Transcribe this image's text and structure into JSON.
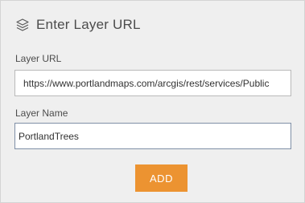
{
  "header": {
    "icon": "layers-icon",
    "title": "Enter Layer URL"
  },
  "form": {
    "url_label": "Layer URL",
    "url_value": "https://www.portlandmaps.com/arcgis/rest/services/Public",
    "name_label": "Layer Name",
    "name_value": "PortlandTrees"
  },
  "actions": {
    "add_label": "ADD"
  },
  "colors": {
    "accent": "#ec9331",
    "panel_background": "#efefef",
    "text": "#4c4c4c"
  }
}
